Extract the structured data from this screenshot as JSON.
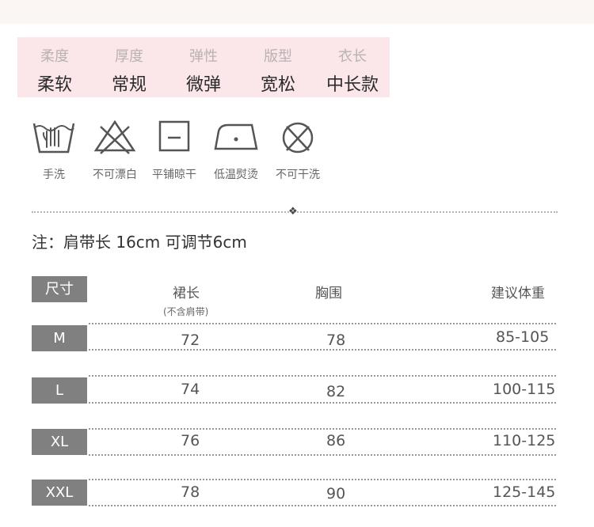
{
  "attributes": [
    {
      "label": "柔度",
      "value": "柔软"
    },
    {
      "label": "厚度",
      "value": "常规"
    },
    {
      "label": "弹性",
      "value": "微弹"
    },
    {
      "label": "版型",
      "value": "宽松"
    },
    {
      "label": "衣长",
      "value": "中长款"
    }
  ],
  "care": [
    {
      "icon": "hand-wash-icon",
      "label": "手洗"
    },
    {
      "icon": "no-bleach-icon",
      "label": "不可漂白"
    },
    {
      "icon": "dry-flat-icon",
      "label": "平铺晾干"
    },
    {
      "icon": "low-iron-icon",
      "label": "低温熨烫"
    },
    {
      "icon": "no-dry-clean-icon",
      "label": "不可干洗"
    }
  ],
  "note": "注：肩带长 16cm 可调节6cm",
  "size_table": {
    "header": {
      "size": "尺寸",
      "length": "裙长",
      "length_sub": "(不含肩带)",
      "chest": "胸围",
      "weight": "建议体重"
    },
    "rows": [
      {
        "size": "M",
        "length": "72",
        "chest": "78",
        "weight": "85-105"
      },
      {
        "size": "L",
        "length": "74",
        "chest": "82",
        "weight": "100-115"
      },
      {
        "size": "XL",
        "length": "76",
        "chest": "86",
        "weight": "110-125"
      },
      {
        "size": "XXL",
        "length": "78",
        "chest": "90",
        "weight": "125-145"
      }
    ]
  }
}
